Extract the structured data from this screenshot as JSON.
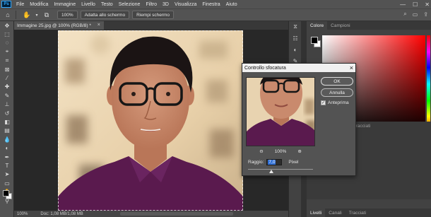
{
  "app": {
    "logo": "Ps",
    "menu": [
      "File",
      "Modifica",
      "Immagine",
      "Livello",
      "Testo",
      "Selezione",
      "Filtro",
      "3D",
      "Visualizza",
      "Finestra",
      "Aiuto"
    ],
    "window_controls": {
      "minimize": "—",
      "maximize": "☐",
      "close": "✕"
    }
  },
  "options_bar": {
    "zoom_value": "100%",
    "fit_screen_label": "Adatta allo schermo",
    "fill_screen_label": "Riempi schermo"
  },
  "document": {
    "tab_title": "Immagine 25.jpg @ 100% (RGB/8) *",
    "close_glyph": "×"
  },
  "status_bar": {
    "zoom": "100%",
    "doc_size": "Doc: 1,08 MB/1,08 MB"
  },
  "panels": {
    "color_tabs": [
      "Colore",
      "Campioni"
    ],
    "middle_tab": "Tracciati",
    "layers_tabs": [
      "Livelli",
      "Canali",
      "Tracciati"
    ]
  },
  "dialog": {
    "title": "Controllo sfocatura",
    "ok_label": "OK",
    "cancel_label": "Annulla",
    "preview_label": "Anteprima",
    "preview_checked": true,
    "zoom_out": "⊖",
    "zoom_level": "100%",
    "zoom_in": "⊕",
    "radius_label": "Raggio:",
    "radius_value": "7,0",
    "radius_unit": "Pixel",
    "radius_slider_fraction": 0.36
  },
  "colors": {
    "accent": "#31a8ff",
    "shirt": "#5a1a4e",
    "skin": "#c98a6d",
    "hair": "#1b1414"
  }
}
